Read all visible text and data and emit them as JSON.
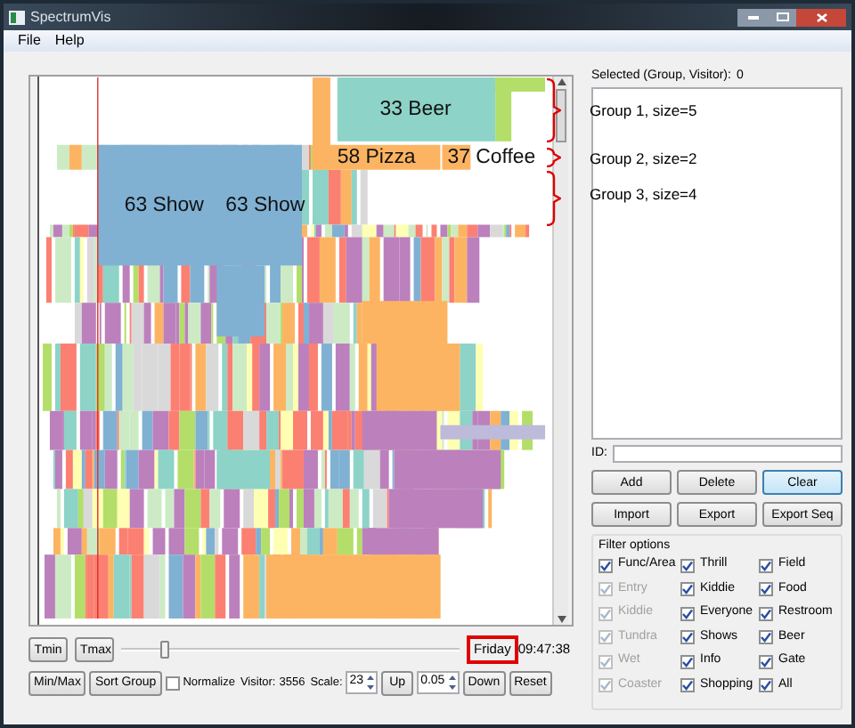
{
  "window": {
    "title": "SpectrumVis"
  },
  "menu": [
    {
      "label": "File"
    },
    {
      "label": "Help"
    }
  ],
  "plot": {
    "labels": [
      {
        "text": "33 Beer"
      },
      {
        "text": "58 Pizza"
      },
      {
        "text": "37 Coffee"
      },
      {
        "text": "63 Show"
      },
      {
        "text": "63 Show"
      }
    ]
  },
  "annotations": [
    {
      "text": "Group 1, size=5"
    },
    {
      "text": "Group 2, size=2"
    },
    {
      "text": "Group 3, size=4"
    }
  ],
  "selection": {
    "label": "Selected (Group, Visitor):",
    "value": "0"
  },
  "id_field": {
    "label": "ID:"
  },
  "buttons": [
    {
      "label": "Add",
      "focused": false
    },
    {
      "label": "Delete",
      "focused": false
    },
    {
      "label": "Clear",
      "focused": true
    },
    {
      "label": "Import",
      "focused": false
    },
    {
      "label": "Export",
      "focused": false
    },
    {
      "label": "Export Seq",
      "focused": false
    }
  ],
  "filter": {
    "title": "Filter options",
    "options": [
      {
        "label": "Func/Area",
        "checked": true,
        "disabled": false
      },
      {
        "label": "Thrill",
        "checked": true,
        "disabled": false
      },
      {
        "label": "Field",
        "checked": true,
        "disabled": false
      },
      {
        "label": "Entry",
        "checked": true,
        "disabled": true
      },
      {
        "label": "Kiddie",
        "checked": true,
        "disabled": false
      },
      {
        "label": "Food",
        "checked": true,
        "disabled": false
      },
      {
        "label": "Kiddie",
        "checked": true,
        "disabled": true
      },
      {
        "label": "Everyone",
        "checked": true,
        "disabled": false
      },
      {
        "label": "Restroom",
        "checked": true,
        "disabled": false
      },
      {
        "label": "Tundra",
        "checked": true,
        "disabled": true
      },
      {
        "label": "Shows",
        "checked": true,
        "disabled": false
      },
      {
        "label": "Beer",
        "checked": true,
        "disabled": false
      },
      {
        "label": "Wet",
        "checked": true,
        "disabled": true
      },
      {
        "label": "Info",
        "checked": true,
        "disabled": false
      },
      {
        "label": "Gate",
        "checked": true,
        "disabled": false
      },
      {
        "label": "Coaster",
        "checked": true,
        "disabled": true
      },
      {
        "label": "Shopping",
        "checked": true,
        "disabled": false
      },
      {
        "label": "All",
        "checked": true,
        "disabled": false
      }
    ]
  },
  "time": {
    "buttons": [
      {
        "label": "Tmin"
      },
      {
        "label": "Tmax"
      }
    ],
    "slider": {
      "level": 0.12
    },
    "day": "Friday",
    "day_highlighted": true,
    "clock": "09:47:38"
  },
  "controls": {
    "min_max": "Min/Max",
    "sort_group": "Sort Group",
    "normalize": {
      "label": "Normalize",
      "checked": false
    },
    "visitor_label": "Visitor:",
    "visitor_value": "3556",
    "scale_label": "Scale:",
    "scale_value": "23",
    "up": "Up",
    "step_value": "0.05",
    "down": "Down",
    "reset": "Reset"
  }
}
